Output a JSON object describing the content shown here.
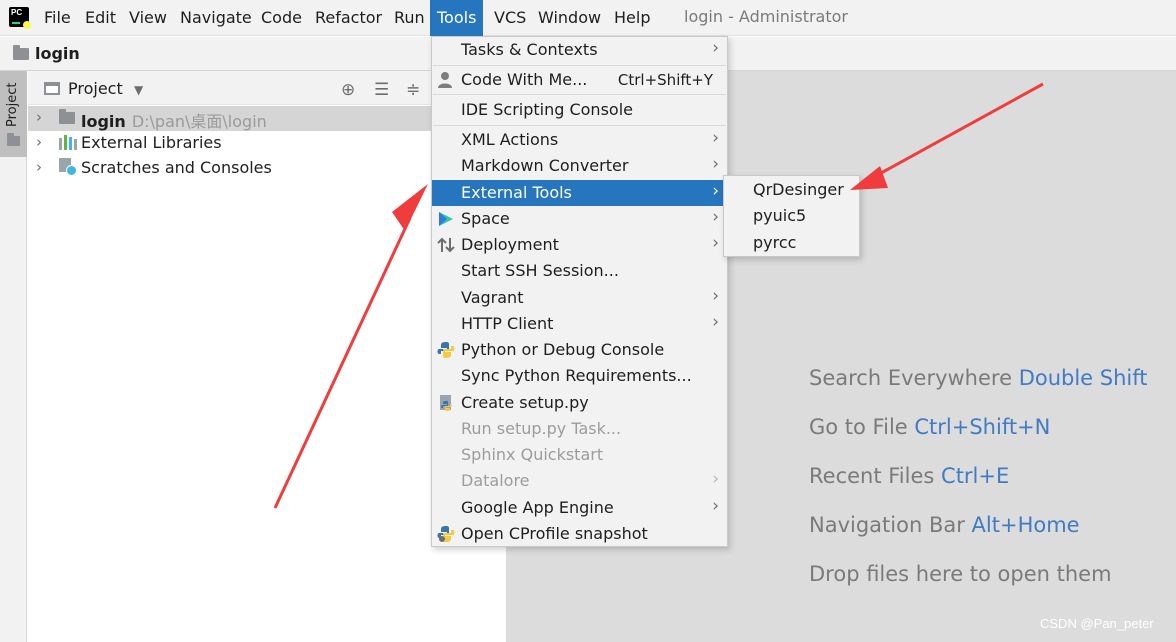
{
  "menubar": {
    "items": [
      "File",
      "Edit",
      "View",
      "Navigate",
      "Code",
      "Refactor",
      "Run",
      "Tools",
      "VCS",
      "Window",
      "Help"
    ],
    "active": "Tools",
    "window_title": "login - Administrator"
  },
  "navbar": {
    "project_name": "login"
  },
  "stripe": {
    "tab_label": "Project"
  },
  "project_panel": {
    "title": "Project",
    "tree": [
      {
        "label": "login",
        "path": "D:\\pan\\桌面\\login",
        "icon": "folder-icon"
      },
      {
        "label": "External Libraries",
        "icon": "libraries-icon"
      },
      {
        "label": "Scratches and Consoles",
        "icon": "scratches-icon"
      }
    ]
  },
  "tools_menu": {
    "items": [
      {
        "label": "Tasks & Contexts",
        "submenu": true
      },
      {
        "label": "Code With Me...",
        "shortcut": "Ctrl+Shift+Y",
        "icon": "person-icon"
      },
      {
        "label": "IDE Scripting Console"
      },
      {
        "label": "XML Actions",
        "submenu": true
      },
      {
        "label": "Markdown Converter",
        "submenu": true
      },
      {
        "label": "External Tools",
        "submenu": true,
        "highlighted": true
      },
      {
        "label": "Space",
        "submenu": true,
        "icon": "space-icon"
      },
      {
        "label": "Deployment",
        "submenu": true,
        "icon": "deployment-icon"
      },
      {
        "label": "Start SSH Session..."
      },
      {
        "label": "Vagrant",
        "submenu": true
      },
      {
        "label": "HTTP Client",
        "submenu": true
      },
      {
        "label": "Python or Debug Console",
        "icon": "python-icon"
      },
      {
        "label": "Sync Python Requirements..."
      },
      {
        "label": "Create setup.py",
        "icon": "setup-py-icon"
      },
      {
        "label": "Run setup.py Task...",
        "disabled": true
      },
      {
        "label": "Sphinx Quickstart",
        "disabled": true
      },
      {
        "label": "Datalore",
        "submenu": true,
        "disabled": true
      },
      {
        "label": "Google App Engine",
        "submenu": true
      },
      {
        "label": "Open CProfile snapshot",
        "icon": "cprofile-icon"
      }
    ]
  },
  "external_tools_submenu": {
    "items": [
      "QrDesinger",
      "pyuic5",
      "pyrcc"
    ]
  },
  "editor_hints": [
    {
      "text": "Search Everywhere",
      "key": "Double Shift"
    },
    {
      "text": "Go to File",
      "key": "Ctrl+Shift+N"
    },
    {
      "text": "Recent Files",
      "key": "Ctrl+E"
    },
    {
      "text": "Navigation Bar",
      "key": "Alt+Home"
    },
    {
      "text": "Drop files here to open them",
      "key": ""
    }
  ],
  "watermark": "CSDN @Pan_peter",
  "colors": {
    "accent": "#2675bf",
    "hint_key": "#3f7cc4",
    "annotation_arrow": "#f03c3c",
    "editor_bg": "#dcdcdc"
  }
}
